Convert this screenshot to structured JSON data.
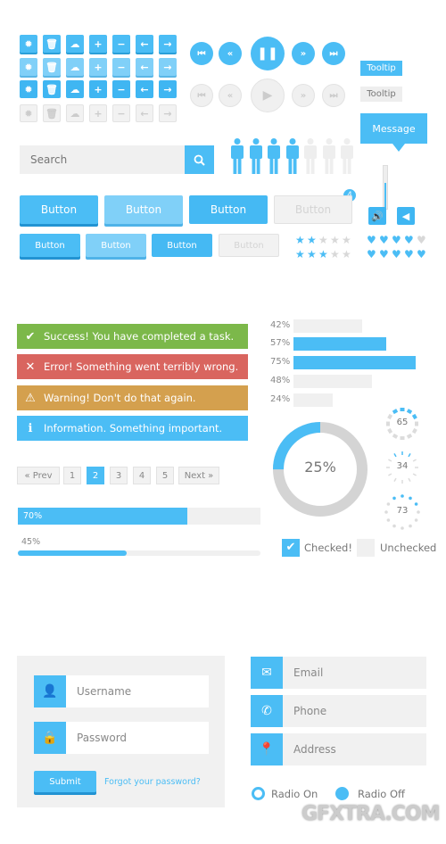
{
  "colors": {
    "accent": "#4bbdf5",
    "success": "#7cb84a",
    "error": "#d9655f",
    "warning": "#d4a04e",
    "info": "#4bbdf5",
    "inactive": "#f0f0f0"
  },
  "icon_grid": {
    "icons": [
      "gear-icon",
      "trash-icon",
      "cloud-icon",
      "plus-icon",
      "minus-icon",
      "arrow-left-icon",
      "arrow-right-icon"
    ],
    "glyphs": [
      "✹",
      "🗑",
      "☁",
      "+",
      "−",
      "←",
      "→"
    ],
    "rows": 4
  },
  "media": {
    "buttons": [
      "skip-back",
      "rewind",
      "pause",
      "fast-forward",
      "skip-forward"
    ],
    "glyphs_on": [
      "⏮",
      "«",
      "❚❚",
      "»",
      "⏭"
    ],
    "glyphs_off": [
      "⏮",
      "«",
      "▶",
      "»",
      "⏭"
    ]
  },
  "tooltips": {
    "primary": "Tooltip",
    "secondary": "Tooltip",
    "message": "Message"
  },
  "search": {
    "placeholder": "Search"
  },
  "people_rating": {
    "filled": 4,
    "total": 7
  },
  "volume": {
    "level": 0.6
  },
  "buttons": {
    "large": [
      "Button",
      "Button",
      "Button",
      "Button"
    ],
    "small": [
      "Button",
      "Button",
      "Button",
      "Button"
    ],
    "badge": "4"
  },
  "stars": [
    {
      "filled": 2,
      "total": 5
    },
    {
      "filled": 3,
      "total": 5
    }
  ],
  "hearts": [
    {
      "filled": 4,
      "total": 5
    },
    {
      "filled": 5,
      "total": 5
    }
  ],
  "alerts": [
    {
      "type": "success",
      "icon": "check-icon",
      "glyph": "✔",
      "text": "Success! You have completed a task."
    },
    {
      "type": "error",
      "icon": "close-icon",
      "glyph": "✕",
      "text": "Error! Something went terribly wrong."
    },
    {
      "type": "warning",
      "icon": "warning-icon",
      "glyph": "⚠",
      "text": "Warning! Don't do that again."
    },
    {
      "type": "info",
      "icon": "info-icon",
      "glyph": "ℹ",
      "text": "Information. Something important."
    }
  ],
  "pagination": {
    "prev": "« Prev",
    "pages": [
      "1",
      "2",
      "3",
      "4",
      "5"
    ],
    "active": "2",
    "next": "Next »"
  },
  "progress": [
    {
      "label": "70%",
      "value": 70
    },
    {
      "label": "45%",
      "value": 45
    }
  ],
  "bar_list": [
    {
      "label": "42%",
      "value": 42,
      "highlight": false
    },
    {
      "label": "57%",
      "value": 57,
      "highlight": true
    },
    {
      "label": "75%",
      "value": 75,
      "highlight": true
    },
    {
      "label": "48%",
      "value": 48,
      "highlight": false
    },
    {
      "label": "24%",
      "value": 24,
      "highlight": false
    }
  ],
  "donut": {
    "label": "25%",
    "value": 25
  },
  "spinners": [
    {
      "label": "65",
      "style": "segments"
    },
    {
      "label": "34",
      "style": "lines"
    },
    {
      "label": "73",
      "style": "dots"
    }
  ],
  "checkboxes": [
    {
      "label": "Checked!",
      "checked": true
    },
    {
      "label": "Unchecked",
      "checked": false
    }
  ],
  "login": {
    "username_placeholder": "Username",
    "password_placeholder": "Password",
    "submit": "Submit",
    "forgot": "Forgot your password?"
  },
  "contact": {
    "email": "Email",
    "phone": "Phone",
    "address": "Address"
  },
  "radios": [
    {
      "label": "Radio On",
      "checked": true
    },
    {
      "label": "Radio Off",
      "checked": false
    }
  ],
  "watermark": "GFXTRA.COM"
}
